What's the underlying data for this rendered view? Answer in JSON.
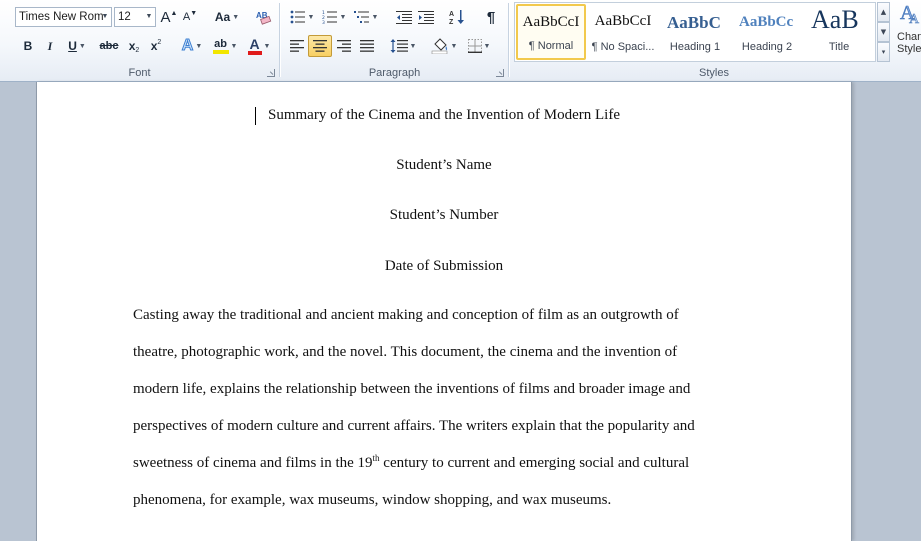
{
  "ribbon": {
    "font": {
      "label": "Font",
      "font_name": "Times New Rom",
      "font_size": "12",
      "grow_glyph": "A",
      "shrink_glyph": "A",
      "change_case": "Aa",
      "bold": "B",
      "italic": "I",
      "underline": "U",
      "strike": "abc",
      "subscript": "x",
      "subscript_mark": "2",
      "superscript": "x",
      "superscript_mark": "2",
      "text_effects": "A",
      "highlight": "ab",
      "font_color": "A",
      "highlight_color": "#f2e600",
      "font_color_value": "#e01b1b"
    },
    "paragraph": {
      "label": "Paragraph",
      "show_marks": "¶"
    },
    "styles": {
      "label": "Styles",
      "items": [
        {
          "sample": "AaBbCcI",
          "name": "¶ Normal",
          "selected": true
        },
        {
          "sample": "AaBbCcI",
          "name": "¶ No Spaci...",
          "selected": false
        },
        {
          "sample": "AaBbC",
          "name": "Heading 1",
          "selected": false
        },
        {
          "sample": "AaBbCc",
          "name": "Heading 2",
          "selected": false
        },
        {
          "sample": "AaB",
          "name": "Title",
          "selected": false
        }
      ],
      "change_styles_label_1": "Chan",
      "change_styles_label_2": "Style"
    }
  },
  "document": {
    "title_lines": [
      "Summary of the Cinema and the Invention of Modern Life",
      "Student’s Name",
      "Student’s Number",
      "Date of Submission"
    ],
    "body_lines": [
      "Casting away the traditional and ancient making and conception of film as an outgrowth of",
      "theatre, photographic work, and the novel. This  document, the cinema  and the invention  of",
      "modern life, explains  the relationship  between the inventions of films and broader image  and",
      "perspectives of modern culture and current affairs. The writers explain  that the popularity and",
      "phenomena,  for example,  wax museums,  window shopping, and wax museums."
    ],
    "line5_before": "sweetness of cinema  and films in the 19",
    "line5_sup": "th",
    "line5_after": " century to current  and emerging  social  and cultural"
  }
}
